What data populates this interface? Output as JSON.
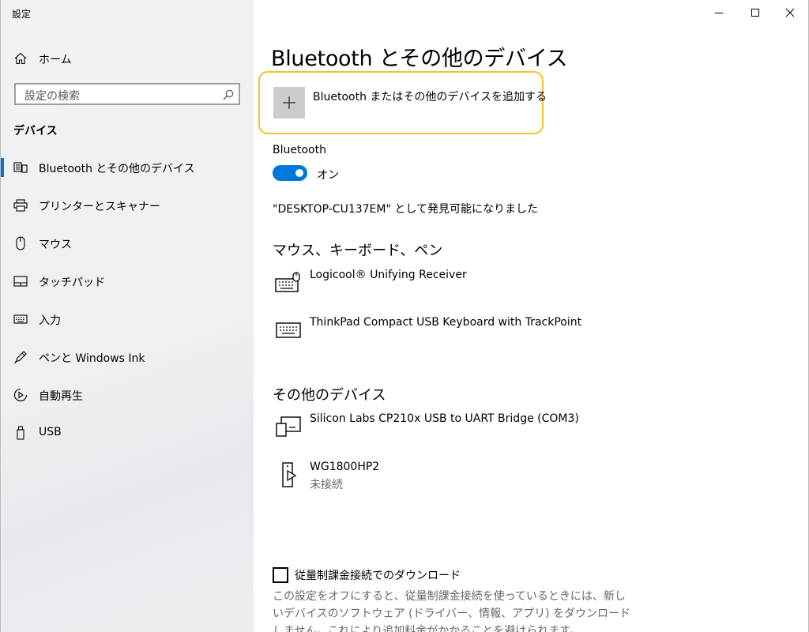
{
  "window": {
    "title": "設定",
    "controls": {
      "minimize": "minimize",
      "maximize": "maximize",
      "close": "close"
    }
  },
  "sidebar": {
    "home_label": "ホーム",
    "search_placeholder": "設定の検索",
    "section_title": "デバイス",
    "items": [
      {
        "label": "Bluetooth とその他のデバイス",
        "icon": "bluetooth-devices-icon",
        "active": true
      },
      {
        "label": "プリンターとスキャナー",
        "icon": "printer-icon"
      },
      {
        "label": "マウス",
        "icon": "mouse-icon"
      },
      {
        "label": "タッチパッド",
        "icon": "touchpad-icon"
      },
      {
        "label": "入力",
        "icon": "keyboard-icon"
      },
      {
        "label": "ペンと Windows Ink",
        "icon": "pen-icon"
      },
      {
        "label": "自動再生",
        "icon": "autoplay-icon"
      },
      {
        "label": "USB",
        "icon": "usb-icon"
      }
    ]
  },
  "main": {
    "title": "Bluetooth とその他のデバイス",
    "add_device_label": "Bluetooth またはその他のデバイスを追加する",
    "bluetooth_label": "Bluetooth",
    "bluetooth_state": "オン",
    "discoverable_text": "\"DESKTOP-CU137EM\" として発見可能になりました",
    "groups": [
      {
        "heading": "マウス、キーボード、ペン",
        "devices": [
          {
            "name": "Logicool® Unifying Receiver",
            "icon": "keyboard-mouse-icon",
            "status": ""
          },
          {
            "name": "ThinkPad Compact USB Keyboard with TrackPoint",
            "icon": "keyboard-icon",
            "status": ""
          }
        ]
      },
      {
        "heading": "その他のデバイス",
        "devices": [
          {
            "name": "Silicon Labs CP210x USB to UART Bridge (COM3)",
            "icon": "generic-device-icon",
            "status": ""
          },
          {
            "name": "WG1800HP2",
            "icon": "media-device-icon",
            "status": "未接続"
          }
        ]
      }
    ],
    "metered_checkbox_label": "従量制課金接続でのダウンロード",
    "metered_checked": false,
    "metered_description": "この設定をオフにすると、従量制課金接続を使っているときには、新しいデバイスのソフトウェア (ドライバー、情報、アプリ) をダウンロードしません。これにより追加料金がかかることを避けられます。"
  },
  "colors": {
    "accent": "#0078d7",
    "focus_ring": "#f5c22b",
    "sidebar_bg": "#f2f2f2"
  }
}
